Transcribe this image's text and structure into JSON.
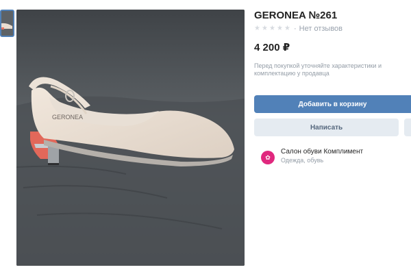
{
  "product": {
    "title": "GERONEA №261",
    "rating_text": "Нет отзывов",
    "rating_stars": 0,
    "price": "4 200 ₽",
    "note": "Перед покупкой уточняйте характеристики и комплектацию у продавца",
    "shoe_brand_print": "GERONEA"
  },
  "actions": {
    "add_to_cart": "Добавить в корзину",
    "message": "Написать"
  },
  "shop": {
    "name": "Салон обуви Комплимент",
    "category": "Одежда, обувь"
  },
  "colors": {
    "accent": "#5181b8",
    "secondary_button": "#e5ebf1",
    "shop_avatar": "#e0287e"
  }
}
